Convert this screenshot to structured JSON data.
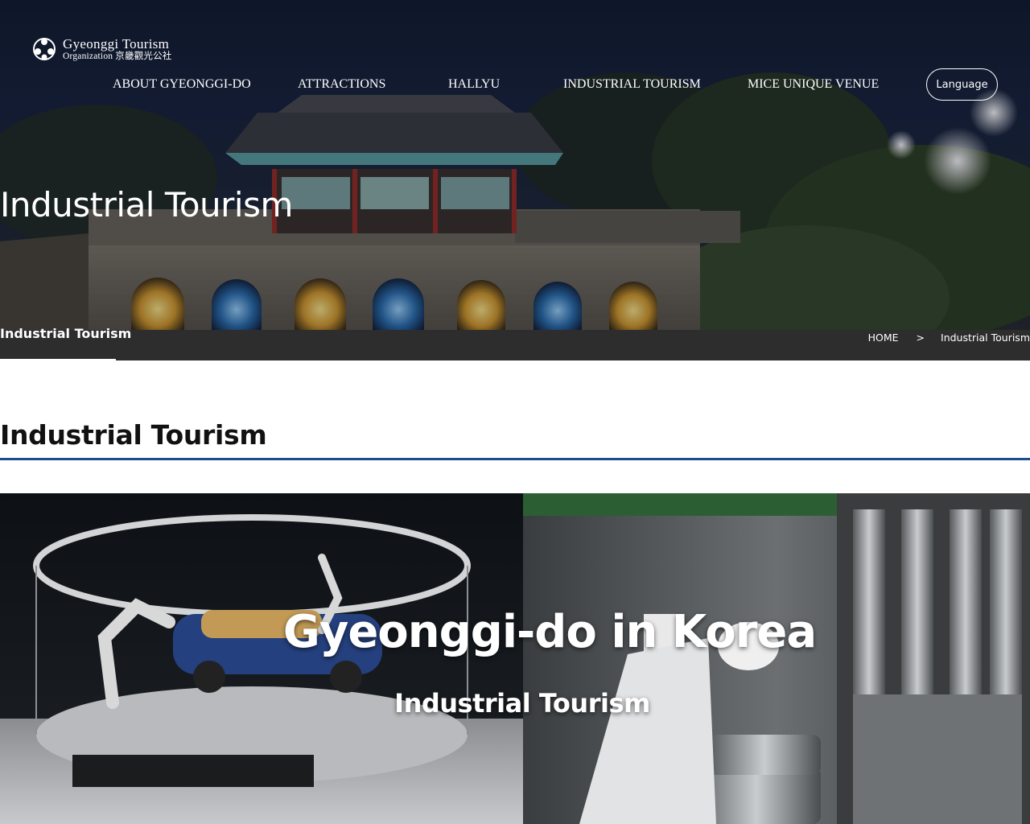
{
  "brand": {
    "line1": "Gyeonggi Tourism",
    "line2": "Organization 京畿觀光公社"
  },
  "nav": {
    "items": [
      {
        "label": "ABOUT GYEONGGI-DO"
      },
      {
        "label": "ATTRACTIONS"
      },
      {
        "label": "HALLYU"
      },
      {
        "label": "INDUSTRIAL TOURISM"
      },
      {
        "label": "MICE UNIQUE VENUE"
      }
    ],
    "language_button": "Language"
  },
  "hero": {
    "title": "Industrial Tourism",
    "sub_tab": "Industrial Tourism",
    "breadcrumb": {
      "home": "HOME",
      "separator": ">",
      "current": "Industrial Tourism"
    }
  },
  "section": {
    "title": "Industrial Tourism"
  },
  "feature": {
    "title": "Gyeonggi-do in Korea",
    "subtitle": "Industrial Tourism"
  },
  "colors": {
    "accent_rule": "#1f4c8f",
    "text_dark": "#111111",
    "text_light": "#ffffff"
  }
}
